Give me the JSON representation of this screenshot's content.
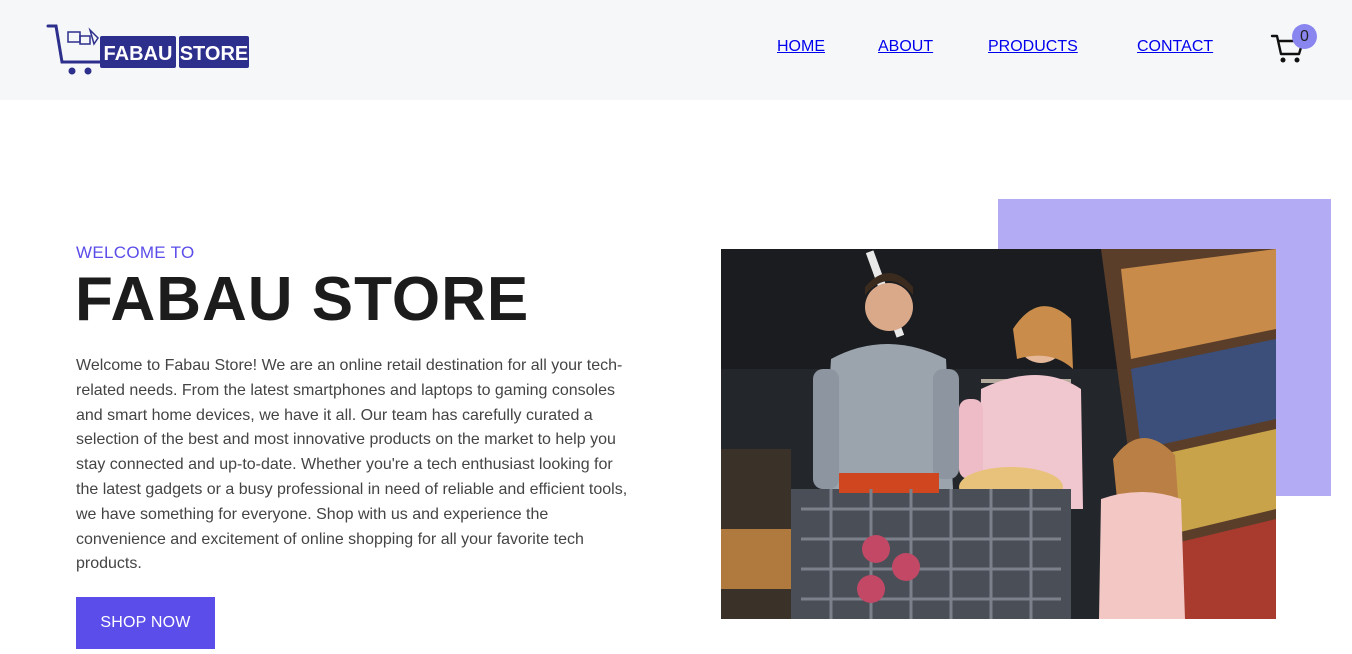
{
  "brand": {
    "logo_text_left": "FABAU",
    "logo_text_right": "STORE",
    "accent_color": "#5b4de9",
    "logo_color": "#2d2f8c"
  },
  "nav": {
    "items": [
      {
        "label": "HOME"
      },
      {
        "label": "ABOUT"
      },
      {
        "label": "PRODUCTS"
      },
      {
        "label": "CONTACT"
      }
    ],
    "cart_icon": "cart-icon",
    "cart_count": "0"
  },
  "hero": {
    "kicker": "WELCOME TO",
    "title": "FABAU STORE",
    "description": "Welcome to Fabau Store! We are an online retail destination for all your tech-related needs. From the latest smartphones and laptops to gaming consoles and smart home devices, we have it all. Our team has carefully curated a selection of the best and most innovative products on the market to help you stay connected and up-to-date. Whether you're a tech enthusiast looking for the latest gadgets or a busy professional in need of reliable and efficient tools, we have something for everyone. Shop with us and experience the convenience and excitement of online shopping for all your favorite tech products.",
    "cta_label": "SHOP NOW",
    "image_alt": "family-shopping-photo",
    "accent_box_color": "#b3abf3"
  }
}
